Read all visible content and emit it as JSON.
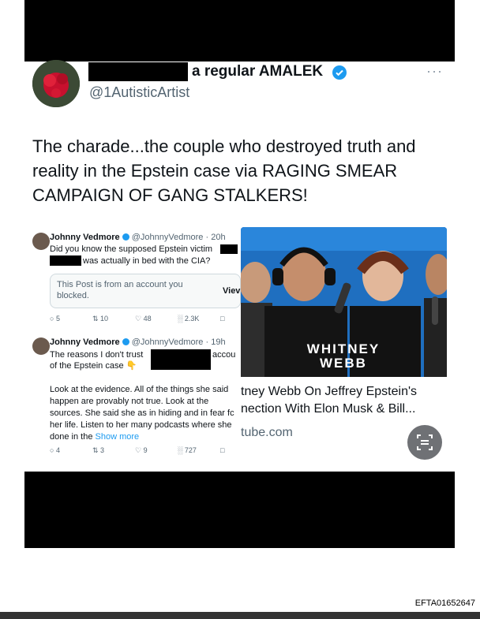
{
  "tweet": {
    "display_name": "a regular AMALEK",
    "handle": "@1AutisticArtist",
    "more_label": "···",
    "text": "The charade...the couple who destroyed truth and reality in the Epstein case via RAGING SMEAR CAMPAIGN OF GANG STALKERS!"
  },
  "embed": {
    "reply1": {
      "name": "Johnny Vedmore",
      "handle_time": "@JohnnyVedmore · 20h",
      "line1": "Did you know the supposed Epstein victim",
      "line2": "was actually in bed with the CIA?",
      "blocked_text": "This Post is from an account you blocked.",
      "view_label": "Viev",
      "replies": "5",
      "retweets": "10",
      "likes": "48",
      "views": "2.3K"
    },
    "reply2": {
      "name": "Johnny Vedmore",
      "handle_time": "@JohnnyVedmore · 19h",
      "line1": "The reasons I don't trust",
      "line1_tail": "accou",
      "line2": "of the Epstein case",
      "emoji": "👇",
      "paragraph": "Look at the evidence. All of the things she said happen are provably not true. Look at the sources. She said she as in hiding and in fear fc her life. Listen to her many podcasts where she done in the",
      "show_more": "Show more",
      "replies": "4",
      "retweets": "3",
      "likes": "9",
      "views": "727"
    },
    "video": {
      "overlay_name": "WHITNEY\nWEBB",
      "title_line1": "tney Webb On Jeffrey Epstein's",
      "title_line2": "nection With Elon Musk & Bill...",
      "domain": "tube.com"
    }
  },
  "footer": {
    "doc_id": "EFTA01652647"
  },
  "colors": {
    "accent": "#1d9bf0",
    "muted": "#536471",
    "redaction": "#000000"
  }
}
